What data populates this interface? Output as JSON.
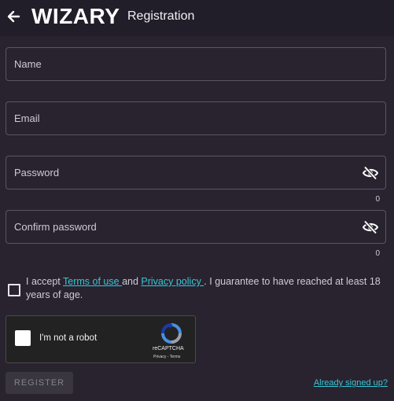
{
  "header": {
    "brand": "WIZARY",
    "title": "Registration"
  },
  "form": {
    "name_placeholder": "Name",
    "email_placeholder": "Email",
    "password_placeholder": "Password",
    "password_counter": "0",
    "confirm_placeholder": "Confirm password",
    "confirm_counter": "0"
  },
  "terms": {
    "prefix": "I accept ",
    "terms_link": "Terms of use ",
    "and": "and ",
    "privacy_link": "Privacy policy ",
    "suffix": ". I guarantee to have reached at least 18 years of age."
  },
  "captcha": {
    "label": "I'm not a robot",
    "brand": "reCAPTCHA",
    "links": "Privacy - Terms"
  },
  "actions": {
    "register_label": "REGISTER",
    "signed_in_link": "Already signed up?"
  },
  "colors": {
    "background": "#28232f",
    "header": "#221e29",
    "link": "#37c6d6"
  },
  "icons": {
    "back": "arrow-left-icon",
    "eye": "eye-off-icon",
    "captcha": "recaptcha-icon"
  }
}
